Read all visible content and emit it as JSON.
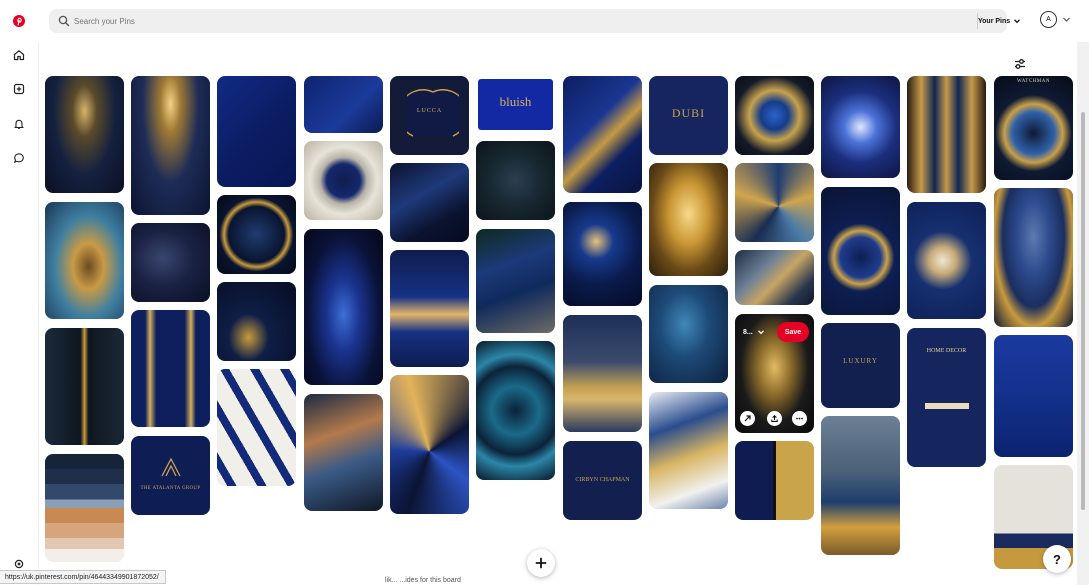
{
  "search": {
    "placeholder": "Search your Pins"
  },
  "filter": {
    "label": "Your Pins"
  },
  "account": {
    "initial": "A"
  },
  "hover_pin": {
    "board": "8...",
    "save_label": "Save"
  },
  "status_bar": {
    "url": "https://uk.pinterest.com/pin/464433499018720​52/"
  },
  "bottom_text": "lik... ...ides for this board",
  "help_label": "?",
  "pin_texts": {
    "bluish": "bluish",
    "dubi": "DUBI",
    "ditail": "LUCCA",
    "atalanta": "THE ATALANTA GROUP",
    "cirbyn": "CIRBYN CHAPMAN",
    "luxury": "LUXURY",
    "home_decor": "HOME DECOR",
    "watch": "WATCHMAN"
  },
  "colors": {
    "brand": "#e60023",
    "navy": "#0f1f5c",
    "gold": "#c9a44a"
  },
  "icons": [
    "pinterest-logo-icon",
    "home-icon",
    "create-icon",
    "notifications-icon",
    "messages-icon",
    "settings-icon",
    "search-icon",
    "chevron-down-icon",
    "tune-icon",
    "share-icon",
    "upload-icon",
    "more-icon",
    "plus-icon"
  ]
}
